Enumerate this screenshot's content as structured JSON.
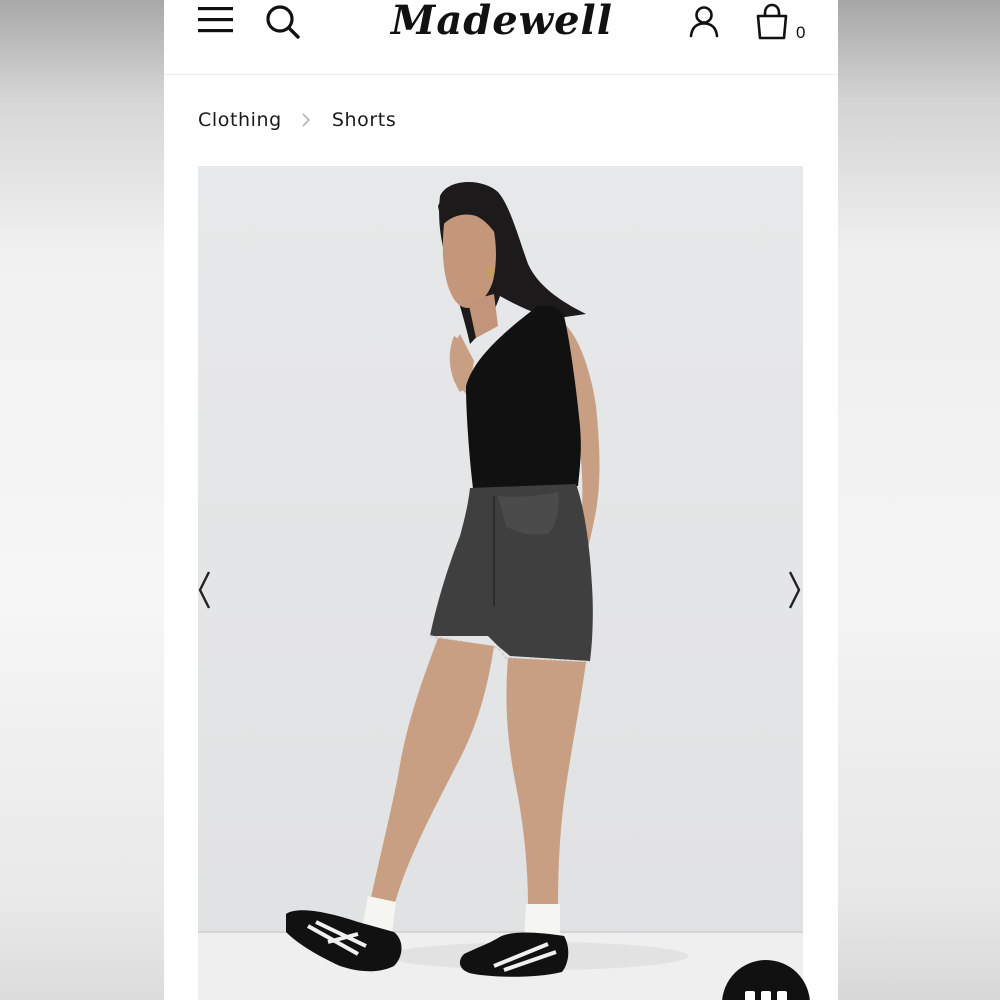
{
  "brand": {
    "name": "Madewell"
  },
  "header": {
    "bag_count": "0",
    "icons": [
      "menu-icon",
      "search-icon",
      "account-icon",
      "bag-icon"
    ]
  },
  "breadcrumb": {
    "items": [
      "Clothing",
      "Shorts"
    ],
    "separator_icon": "chevron-right-icon"
  },
  "gallery": {
    "prev_icon": "chevron-left-icon",
    "next_icon": "chevron-right-icon"
  },
  "chat": {
    "icon": "chat-dots-icon"
  },
  "colors": {
    "text": "#111111",
    "background": "#ffffff",
    "photo_background": "#e5e6e7",
    "chat_button": "#111111"
  }
}
